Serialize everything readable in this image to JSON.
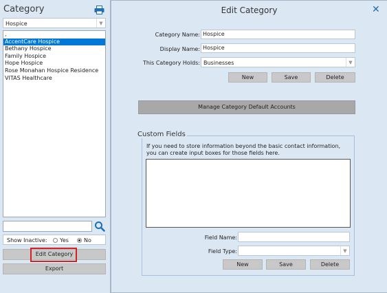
{
  "left": {
    "title": "Category",
    "dropdown_value": "Hospice",
    "list_items": [
      ",",
      "AccentCare Hospice",
      "Bethany Hospice",
      "Family Hospice",
      "Hope Hospice",
      "Rose Monahan Hospice Residence",
      "VITAS Healthcare"
    ],
    "selected_index": 1,
    "show_inactive_label": "Show Inactive:",
    "radio_yes": "Yes",
    "radio_no": "No",
    "edit_button": "Edit Category",
    "export_button": "Export"
  },
  "dialog": {
    "title": "Edit Category",
    "close": "✕",
    "category_name_label": "Category Name:",
    "category_name_value": "Hospice",
    "display_name_label": "Display Name:",
    "display_name_value": "Hospice",
    "holds_label": "This Category Holds:",
    "holds_value": "Businesses",
    "new_button": "New",
    "save_button": "Save",
    "delete_button": "Delete",
    "manage_button": "Manage Category Default Accounts",
    "custom_fields": {
      "legend": "Custom Fields",
      "desc_line1": "If you need to store information beyond the basic contact information,",
      "desc_line2": "you can create input boxes for those fields here.",
      "field_name_label": "Field Name:",
      "field_type_label": "Field Type:",
      "new_button": "New",
      "save_button": "Save",
      "delete_button": "Delete"
    }
  }
}
